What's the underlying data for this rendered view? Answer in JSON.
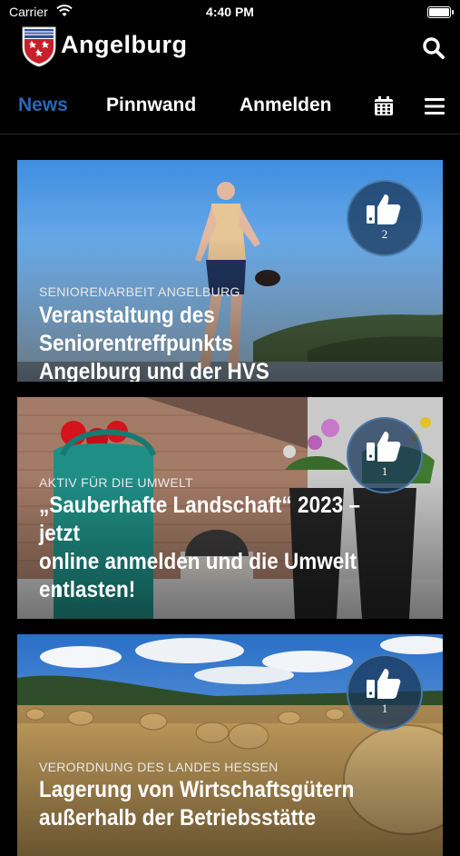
{
  "status_bar": {
    "carrier": "Carrier",
    "time": "4:40 PM"
  },
  "header": {
    "title": "Angelburg"
  },
  "tabs": [
    {
      "label": "News",
      "active": true
    },
    {
      "label": "Pinnwand",
      "active": false
    },
    {
      "label": "Anmelden",
      "active": false
    }
  ],
  "icons": {
    "search": "search-icon",
    "calendar": "calendar-icon",
    "menu": "hamburger-menu-icon",
    "like": "thumbs-up-icon"
  },
  "colors": {
    "active_tab": "#2a67b8",
    "background": "#000000"
  },
  "cards": [
    {
      "category": "Seniorenarbeit Angelburg",
      "headline_line1": "Veranstaltung des Seniorentreffpunkts",
      "headline_line2": "Angelburg und der HVS",
      "likes": "2"
    },
    {
      "category": "Aktiv für die Umwelt",
      "headline_line1": "„Sauberhafte Landschaft“ 2023 – jetzt",
      "headline_line2": "online anmelden und die Umwelt",
      "headline_line3": "entlasten!",
      "likes": "1"
    },
    {
      "category": "Verordnung des Landes Hessen",
      "headline_line1": "Lagerung von Wirtschaftsgütern",
      "headline_line2": "außerhalb der Betriebsstätte",
      "likes": "1"
    }
  ]
}
